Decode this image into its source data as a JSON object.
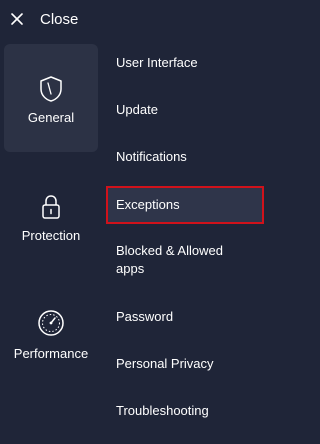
{
  "header": {
    "close_label": "Close"
  },
  "categories": [
    {
      "label": "General",
      "icon": "shield-icon",
      "active": true
    },
    {
      "label": "Protection",
      "icon": "lock-icon",
      "active": false
    },
    {
      "label": "Performance",
      "icon": "speedometer-icon",
      "active": false
    }
  ],
  "menu": {
    "items": [
      {
        "label": "User Interface"
      },
      {
        "label": "Update"
      },
      {
        "label": "Notifications"
      },
      {
        "label": "Exceptions",
        "selected": true
      },
      {
        "label": "Blocked & Allowed apps"
      },
      {
        "label": "Password"
      },
      {
        "label": "Personal Privacy"
      },
      {
        "label": "Troubleshooting"
      }
    ]
  },
  "colors": {
    "background": "#1f2538",
    "active_category_bg": "#2c3245",
    "selection_border": "#d0121b",
    "text": "#ffffff"
  }
}
